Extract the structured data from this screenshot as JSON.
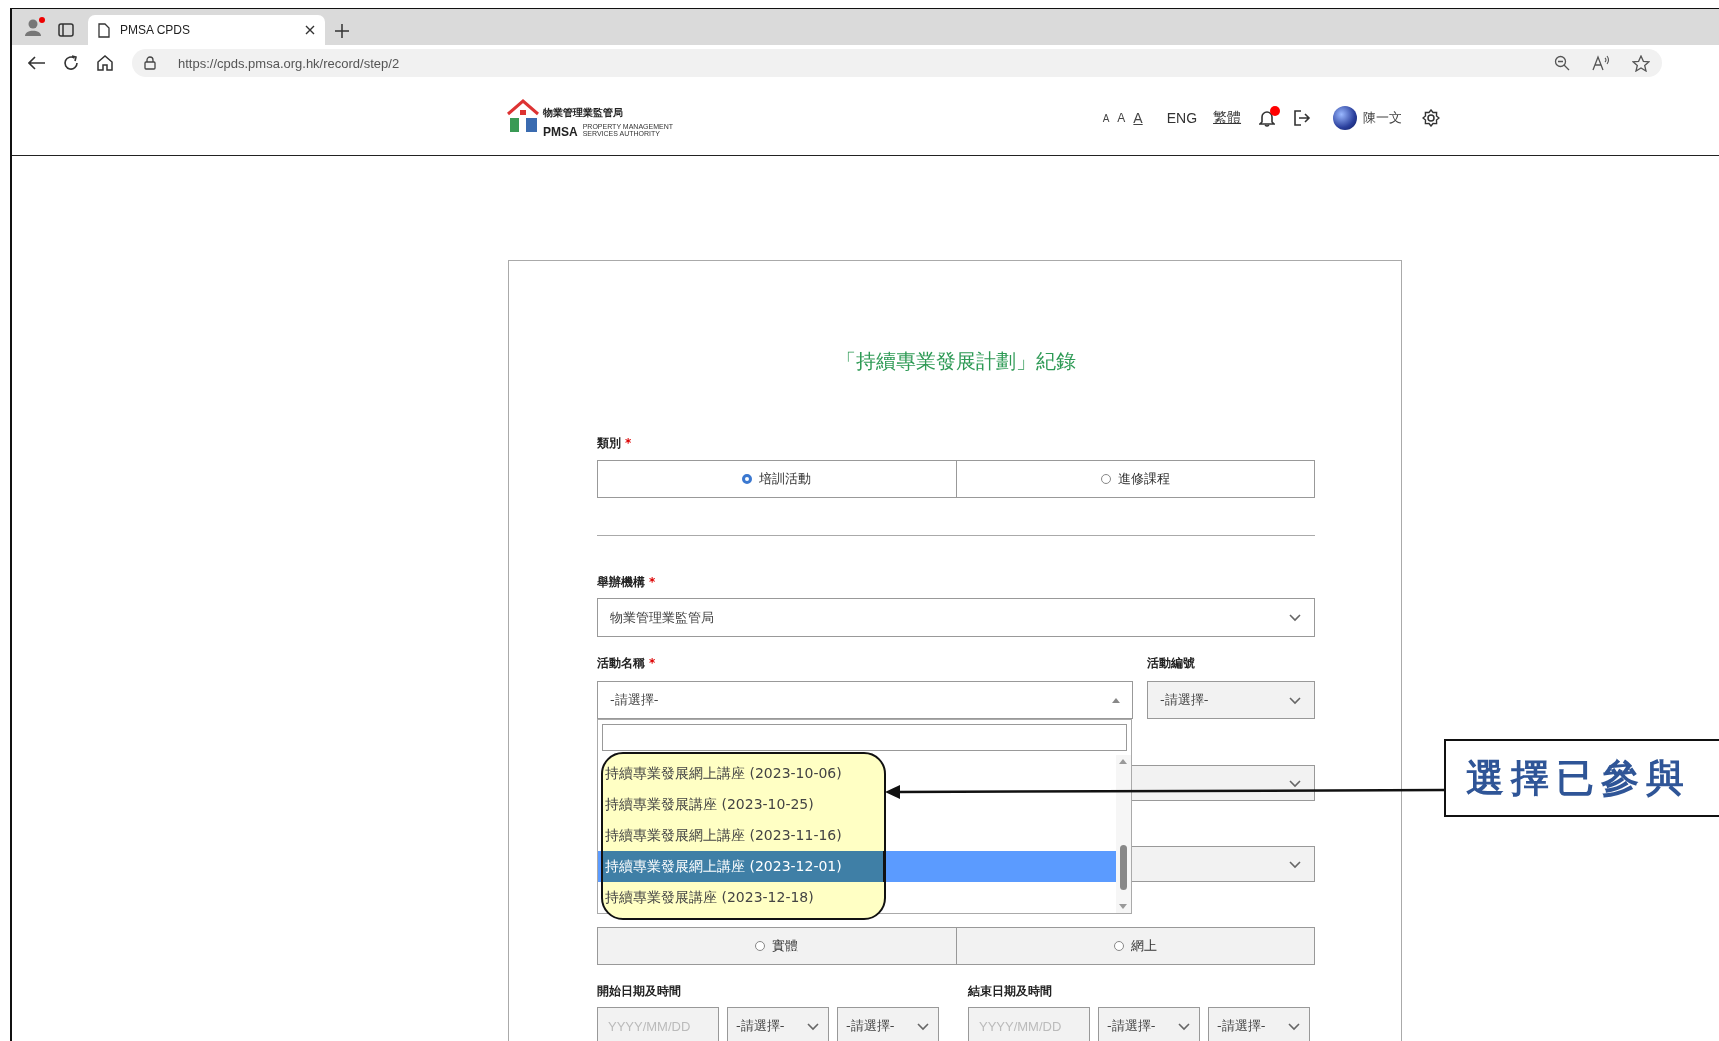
{
  "browser": {
    "tab": {
      "title": "PMSA CPDS"
    },
    "url": "https://cpds.pmsa.org.hk/record/step/2"
  },
  "header": {
    "logo": {
      "name_zh": "物業管理業監管局",
      "abbr": "PMSA",
      "name_en": "PROPERTY MANAGEMENT SERVICES AUTHORITY"
    },
    "font_sizes": [
      {
        "label": "A",
        "selected": false
      },
      {
        "label": "A",
        "selected": false
      },
      {
        "label": "A",
        "selected": true
      }
    ],
    "languages": [
      {
        "label": "ENG",
        "selected": false
      },
      {
        "label": "繁體",
        "selected": true
      }
    ],
    "notifications": {
      "unread": true
    },
    "user": {
      "name": "陳一文"
    }
  },
  "form": {
    "title": "「持續專業發展計劃」紀錄",
    "category": {
      "label": "類別",
      "required_mark": "*",
      "disabled": false,
      "options": [
        {
          "label": "培訓活動",
          "selected": true
        },
        {
          "label": "進修課程",
          "selected": false
        }
      ]
    },
    "organizer": {
      "label": "舉辦機構",
      "required_mark": "*",
      "value": "物業管理業監管局",
      "disabled": false
    },
    "activity_name": {
      "label": "活動名稱",
      "required_mark": "*",
      "value": "-請選擇-",
      "expanded": true,
      "options": [
        {
          "label": "持續專業發展網上講座 (2023-10-06)",
          "selected": false
        },
        {
          "label": "持續專業發展講座 (2023-10-25)",
          "selected": false
        },
        {
          "label": "持續專業發展網上講座 (2023-11-16)",
          "selected": false
        },
        {
          "label": "持續專業發展網上講座 (2023-12-01)",
          "selected": true
        },
        {
          "label": "持續專業發展講座 (2023-12-18)",
          "selected": false
        }
      ]
    },
    "activity_code": {
      "label": "活動編號",
      "value": "-請選擇-",
      "disabled": true
    },
    "covered_fields": [
      {
        "disabled": true
      },
      {
        "disabled": true
      }
    ],
    "mode": {
      "disabled": true,
      "options": [
        {
          "label": "實體",
          "selected": false
        },
        {
          "label": "網上",
          "selected": false
        }
      ]
    },
    "start": {
      "label": "開始日期及時間",
      "date_placeholder": "YYYY/MM/DD",
      "selects": [
        "-請選擇-",
        "-請選擇-"
      ],
      "disabled": true
    },
    "end": {
      "label": "結束日期及時間",
      "date_placeholder": "YYYY/MM/DD",
      "selects": [
        "-請選擇-",
        "-請選擇-"
      ],
      "disabled": true
    }
  },
  "callout": {
    "text": "選擇已參與"
  }
}
